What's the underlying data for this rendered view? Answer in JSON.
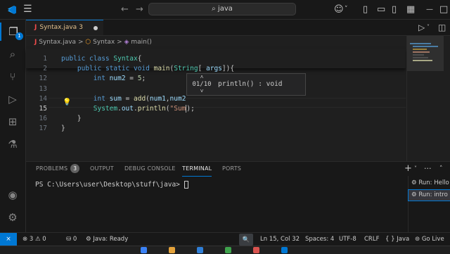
{
  "titlebar": {
    "search_text": "java",
    "icons": [
      "hamburger-icon",
      "back-arrow-icon",
      "forward-arrow-icon",
      "search-icon",
      "copilot-icon",
      "layout-sidebar-left-icon",
      "layout-panel-icon",
      "layout-sidebar-right-icon",
      "customize-layout-icon",
      "minimize-icon",
      "restore-icon",
      "close-icon"
    ]
  },
  "activitybar": {
    "items": [
      "explorer-icon",
      "search-icon",
      "source-control-icon",
      "run-debug-icon",
      "extensions-icon",
      "testing-icon"
    ],
    "explorer_badge": "1",
    "bottom_items": [
      "account-icon",
      "settings-gear-icon"
    ]
  },
  "tab": {
    "icon_text": "J",
    "name": "Syntax.java",
    "problem_count": "3"
  },
  "breadcrumb": {
    "file": "Syntax.java",
    "class": "Syntax",
    "method": "main()",
    "sep": ">"
  },
  "editor": {
    "lines": [
      {
        "num": "1",
        "tokens": [
          [
            "kw",
            "public "
          ],
          [
            "kw",
            "class "
          ],
          [
            "ty",
            "Syntax"
          ],
          [
            "",
            "{"
          ]
        ]
      },
      {
        "num": "2",
        "tokens": [
          [
            "",
            "    "
          ],
          [
            "kw",
            "public "
          ],
          [
            "kw",
            "static "
          ],
          [
            "kw",
            "void "
          ],
          [
            "fn",
            "main"
          ],
          [
            "",
            "("
          ],
          [
            "ty",
            "String"
          ],
          [
            "",
            "[ "
          ],
          [
            "var",
            "args"
          ],
          [
            "",
            "]){"
          ]
        ]
      },
      {
        "num": "12",
        "tokens": [
          [
            "",
            "        "
          ],
          [
            "kw",
            "int "
          ],
          [
            "var",
            "num2"
          ],
          [
            "",
            " = "
          ],
          [
            "num",
            "5"
          ],
          [
            "",
            ";"
          ]
        ]
      },
      {
        "num": "13",
        "tokens": [
          [
            "",
            ""
          ]
        ]
      },
      {
        "num": "14",
        "tokens": [
          [
            "",
            "        "
          ],
          [
            "kw",
            "int "
          ],
          [
            "var",
            "sum"
          ],
          [
            "",
            " = "
          ],
          [
            "fn",
            "add"
          ],
          [
            "",
            "("
          ],
          [
            "var",
            "num1"
          ],
          [
            "",
            ","
          ],
          [
            "var",
            "num2"
          ]
        ]
      },
      {
        "num": "15",
        "tokens": [
          [
            "",
            "        "
          ],
          [
            "ty",
            "System"
          ],
          [
            "",
            "."
          ],
          [
            "var",
            "out"
          ],
          [
            "",
            "."
          ],
          [
            "fn",
            "println"
          ],
          [
            "",
            "("
          ],
          [
            "str",
            "\"Sum"
          ]
        ],
        "after": ");"
      },
      {
        "num": "16",
        "tokens": [
          [
            "",
            "    "
          ],
          [
            "",
            "}"
          ]
        ]
      },
      {
        "num": "17",
        "tokens": [
          [
            "",
            "}"
          ]
        ]
      }
    ],
    "hint": {
      "position": "01/10",
      "signature": "println() : void",
      "up": "˄",
      "down": "˅"
    }
  },
  "panel": {
    "tabs": [
      "PROBLEMS",
      "OUTPUT",
      "DEBUG CONSOLE",
      "TERMINAL",
      "PORTS"
    ],
    "problems_count": "3",
    "terminal_prompt": "PS C:\\Users\\user\\Desktop\\stuff\\java> ",
    "terminals": [
      "Run: Hello",
      "Run: intro"
    ],
    "icons": [
      "add-terminal-icon",
      "terminal-dropdown-icon",
      "more-actions-icon",
      "maximize-panel-icon",
      "close-panel-icon"
    ]
  },
  "statusbar": {
    "remote": "⨯",
    "errors": "3",
    "warnings": "0",
    "ports": "0",
    "java": "Java: Ready",
    "cursor": "Ln 15, Col 32",
    "spaces": "Spaces: 4",
    "encoding": "UTF-8",
    "eol": "CRLF",
    "language": "Java",
    "golive": "Go Live"
  }
}
